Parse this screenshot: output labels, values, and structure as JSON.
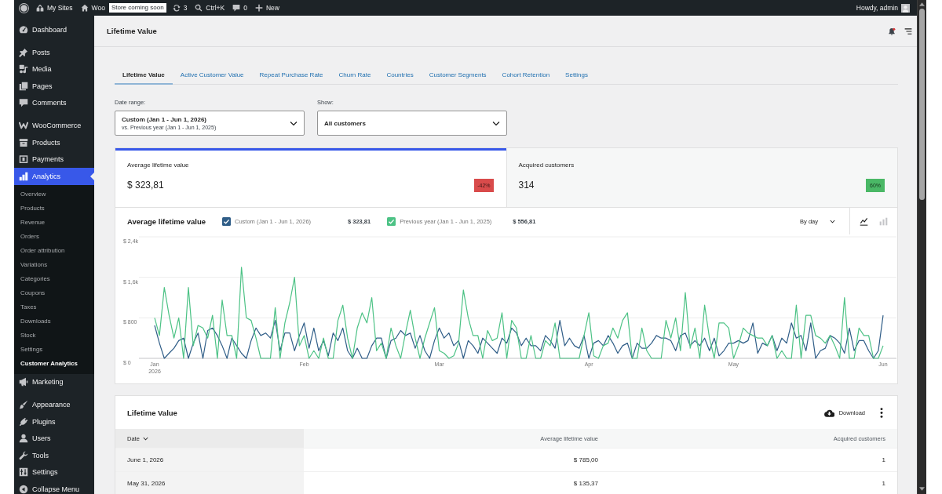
{
  "admin_bar": {
    "items": [
      {
        "kind": "sites",
        "label": "My Sites"
      },
      {
        "kind": "home",
        "label": "Woo"
      },
      {
        "kind": "badge",
        "label": "Store coming soon"
      },
      {
        "kind": "updates",
        "label": "3"
      },
      {
        "kind": "search",
        "label": "Ctrl+K"
      },
      {
        "kind": "comments",
        "label": "0"
      },
      {
        "kind": "plus",
        "label": "New"
      }
    ],
    "greeting": "Howdy, admin"
  },
  "sidebar": {
    "groups": [
      {
        "items": [
          {
            "kind": "dashboard",
            "label": "Dashboard",
            "selected": false
          }
        ]
      },
      {
        "items": [
          {
            "kind": "pin",
            "label": "Posts",
            "selected": false
          },
          {
            "kind": "media",
            "label": "Media",
            "selected": false
          },
          {
            "kind": "pages",
            "label": "Pages",
            "selected": false
          },
          {
            "kind": "comments",
            "label": "Comments",
            "selected": false
          }
        ]
      },
      {
        "items": [
          {
            "kind": "woo",
            "label": "WooCommerce",
            "selected": false
          },
          {
            "kind": "box",
            "label": "Products",
            "selected": false
          },
          {
            "kind": "payments",
            "label": "Payments",
            "selected": false
          },
          {
            "kind": "chart",
            "label": "Analytics",
            "selected": true,
            "children": [
              {
                "label": "Overview",
                "selected": false
              },
              {
                "label": "Products",
                "selected": false
              },
              {
                "label": "Revenue",
                "selected": false
              },
              {
                "label": "Orders",
                "selected": false
              },
              {
                "label": "Order attribution",
                "selected": false
              },
              {
                "label": "Variations",
                "selected": false
              },
              {
                "label": "Categories",
                "selected": false
              },
              {
                "label": "Coupons",
                "selected": false
              },
              {
                "label": "Taxes",
                "selected": false
              },
              {
                "label": "Downloads",
                "selected": false
              },
              {
                "label": "Stock",
                "selected": false
              },
              {
                "label": "Settings",
                "selected": false
              },
              {
                "label": "Customer Analytics",
                "selected": true
              }
            ]
          },
          {
            "kind": "megaphone",
            "label": "Marketing",
            "selected": false
          }
        ]
      },
      {
        "items": [
          {
            "kind": "brush",
            "label": "Appearance",
            "selected": false
          },
          {
            "kind": "plug",
            "label": "Plugins",
            "selected": false
          },
          {
            "kind": "user",
            "label": "Users",
            "selected": false
          },
          {
            "kind": "wrench",
            "label": "Tools",
            "selected": false
          },
          {
            "kind": "sliders",
            "label": "Settings",
            "selected": false
          },
          {
            "kind": "collapse",
            "label": "Collapse Menu",
            "selected": false
          }
        ]
      }
    ]
  },
  "page_title": "Lifetime Value",
  "tabs": [
    {
      "label": "Lifetime Value",
      "selected": true
    },
    {
      "label": "Active Customer Value",
      "selected": false
    },
    {
      "label": "Repeat Purchase Rate",
      "selected": false
    },
    {
      "label": "Churn Rate",
      "selected": false
    },
    {
      "label": "Countries",
      "selected": false
    },
    {
      "label": "Customer Segments",
      "selected": false
    },
    {
      "label": "Cohort Retention",
      "selected": false
    },
    {
      "label": "Settings",
      "selected": false
    }
  ],
  "filters": [
    {
      "label": "Date range:",
      "value": "Custom (Jan 1 - Jun 1, 2026)",
      "comparison": "vs. Previous year (Jan 1 - Jun 1, 2025)"
    },
    {
      "label": "Show:",
      "value": "All customers"
    }
  ],
  "summary": [
    {
      "label": "Average lifetime value",
      "value": "$ 323,81",
      "delta": "-42%",
      "color": "#d94b4b",
      "selected": true
    },
    {
      "label": "Acquired customers",
      "value": "314",
      "delta": "60%",
      "color": "#4ab866",
      "selected": false
    }
  ],
  "chart": {
    "legend": [
      {
        "checked": true,
        "total": "$ 323,81"
      },
      {
        "checked": true,
        "total": "$ 556,81"
      }
    ],
    "interval": "By day",
    "view_modes": [
      {
        "kind": "line",
        "selected": true
      },
      {
        "kind": "bar",
        "selected": false
      }
    ],
    "chart_data": {
      "type": "line",
      "title": "Average lifetime value",
      "categories": [
        "Jan\n2026",
        null,
        null,
        null,
        null,
        null,
        null,
        null,
        null,
        null,
        null,
        null,
        null,
        null,
        null,
        null,
        null,
        null,
        null,
        null,
        null,
        null,
        null,
        null,
        null,
        null,
        null,
        null,
        null,
        null,
        null,
        "Feb",
        null,
        null,
        null,
        null,
        null,
        null,
        null,
        null,
        null,
        null,
        null,
        null,
        null,
        null,
        null,
        null,
        null,
        null,
        null,
        null,
        null,
        null,
        null,
        null,
        null,
        null,
        null,
        "Mar",
        null,
        null,
        null,
        null,
        null,
        null,
        null,
        null,
        null,
        null,
        null,
        null,
        null,
        null,
        null,
        null,
        null,
        null,
        null,
        null,
        null,
        null,
        null,
        null,
        null,
        null,
        null,
        null,
        null,
        null,
        "Apr",
        null,
        null,
        null,
        null,
        null,
        null,
        null,
        null,
        null,
        null,
        null,
        null,
        null,
        null,
        null,
        null,
        null,
        null,
        null,
        null,
        null,
        null,
        null,
        null,
        null,
        null,
        null,
        null,
        null,
        "May",
        null,
        null,
        null,
        null,
        null,
        null,
        null,
        null,
        null,
        null,
        null,
        null,
        null,
        null,
        null,
        null,
        null,
        null,
        null,
        null,
        null,
        null,
        null,
        null,
        null,
        null,
        null,
        null,
        null,
        null,
        "Jun"
      ],
      "ylim": [
        0,
        2400
      ],
      "yticks": [
        {
          "value": 0,
          "label": "$ 0"
        },
        {
          "value": 800,
          "label": "$ 800"
        },
        {
          "value": 1600,
          "label": "$ 1,6k"
        },
        {
          "value": 2400,
          "label": "$ 2,4k"
        }
      ],
      "series": [
        {
          "name": "Custom (Jan 1 - Jun 1, 2026)",
          "color": "#2f5d87",
          "values": [
            650,
            300,
            0,
            100,
            200,
            350,
            400,
            0,
            300,
            500,
            0,
            550,
            600,
            450,
            250,
            0,
            400,
            250,
            100,
            0,
            350,
            600,
            450,
            500,
            400,
            750,
            150,
            500,
            500,
            150,
            450,
            700,
            200,
            600,
            150,
            350,
            50,
            500,
            350,
            600,
            150,
            0,
            200,
            0,
            0,
            250,
            400,
            400,
            0,
            350,
            400,
            550,
            450,
            500,
            200,
            450,
            150,
            0,
            350,
            600,
            400,
            500,
            250,
            350,
            0,
            350,
            250,
            100,
            400,
            300,
            200,
            100,
            400,
            300,
            600,
            500,
            250,
            400,
            250,
            250,
            150,
            450,
            350,
            200,
            750,
            250,
            400,
            250,
            200,
            450,
            0,
            300,
            350,
            250,
            450,
            300,
            100,
            250,
            300,
            0,
            300,
            200,
            200,
            300,
            450,
            400,
            400,
            350,
            150,
            450,
            500,
            250,
            350,
            250,
            400,
            150,
            400,
            50,
            150,
            300,
            300,
            350,
            300,
            350,
            700,
            100,
            300,
            250,
            450,
            150,
            400,
            300,
            700,
            400,
            450,
            150,
            700,
            0,
            150,
            200,
            450,
            400,
            300,
            100,
            600,
            150,
            350,
            350,
            150,
            0,
            150,
            850
          ]
        },
        {
          "name": "Previous year (Jan 1 - Jun 1, 2025)",
          "color": "#4cc285",
          "values": [
            800,
            450,
            1400,
            850,
            400,
            800,
            0,
            1400,
            250,
            650,
            600,
            400,
            850,
            0,
            1150,
            450,
            450,
            0,
            1800,
            800,
            750,
            400,
            0,
            0,
            0,
            1000,
            0,
            700,
            1100,
            1600,
            250,
            450,
            0,
            150,
            0,
            400,
            0,
            0,
            750,
            1050,
            400,
            0,
            600,
            900,
            700,
            1200,
            150,
            300,
            0,
            600,
            250,
            0,
            500,
            950,
            400,
            0,
            400,
            700,
            1000,
            150,
            100,
            0,
            50,
            300,
            1350,
            800,
            450,
            450,
            0,
            550,
            350,
            400,
            900,
            0,
            750,
            600,
            0,
            0,
            450,
            0,
            0,
            350,
            250,
            700,
            0,
            0,
            0,
            0,
            0,
            450,
            900,
            50,
            0,
            250,
            300,
            600,
            400,
            750,
            900,
            0,
            0,
            600,
            150,
            0,
            0,
            0,
            750,
            400,
            800,
            150,
            1300,
            200,
            600,
            0,
            1050,
            400,
            0,
            700,
            700,
            600,
            0,
            250,
            600,
            500,
            450,
            400,
            400,
            250,
            450,
            0,
            150,
            0,
            0,
            1050,
            0,
            850,
            850,
            450,
            400,
            300,
            450,
            250,
            0,
            1200,
            0,
            0,
            600,
            450,
            450,
            0,
            0,
            250
          ]
        }
      ]
    }
  },
  "table": {
    "title": "Lifetime Value",
    "download": "Download",
    "columns": [
      {
        "label": "Date",
        "sorted": true
      },
      {
        "label": "Average lifetime value",
        "sorted": false
      },
      {
        "label": "Acquired customers",
        "sorted": false
      }
    ],
    "rows": [
      [
        "June 1, 2026",
        "$ 785,00",
        "1"
      ],
      [
        "May 31, 2026",
        "$ 135,37",
        "1"
      ]
    ]
  }
}
